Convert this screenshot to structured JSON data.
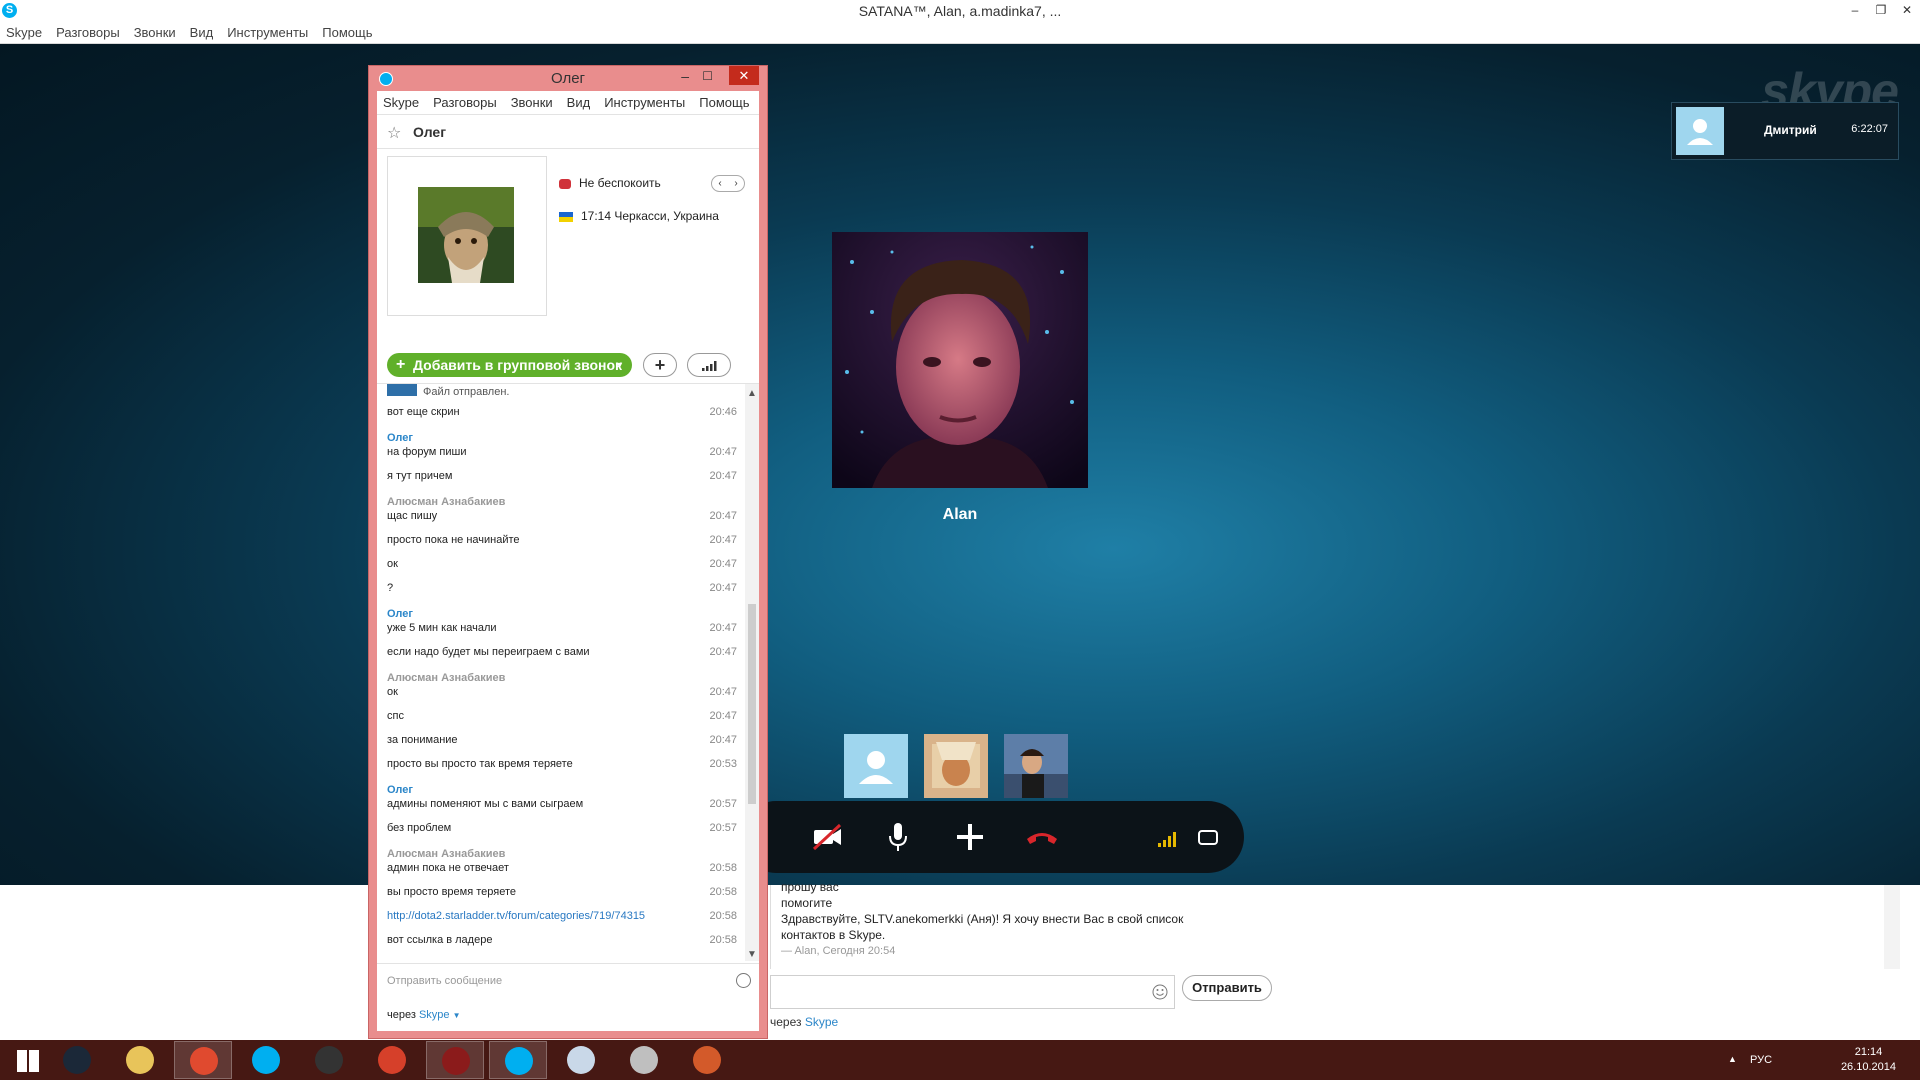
{
  "main_window": {
    "title": "SATANA™, Alan, a.madinka7, ...",
    "menu": [
      "Skype",
      "Разговоры",
      "Звонки",
      "Вид",
      "Инструменты",
      "Помощь"
    ],
    "window_controls": [
      "–",
      "❐",
      "✕"
    ]
  },
  "call": {
    "watermark": "skype",
    "notification": {
      "name": "Дмитрий",
      "time": "6:22:07"
    },
    "remote_participant": "Alan",
    "participants_thumbnails": [
      "default-avatar",
      "photo",
      "photo"
    ],
    "controls": [
      "video-off-icon",
      "microphone-icon",
      "plus-icon",
      "hang-up-icon",
      "signal-icon",
      "fullscreen-icon"
    ]
  },
  "main_chat": {
    "lines": [
      "прошу вас",
      "помогите",
      "Здравствуйте, SLTV.anekomerkki (Аня)! Я хочу внести Вас в свой список",
      "контактов в Skype."
    ],
    "meta": "— Alan, Сегодня 20:54",
    "send_label": "Отправить",
    "via_prefix": "через",
    "via_service": "Skype"
  },
  "chat_window": {
    "title": "Олег",
    "menu": [
      "Skype",
      "Разговоры",
      "Звонки",
      "Вид",
      "Инструменты",
      "Помощь"
    ],
    "contact_name": "Олег",
    "status": "Не беспокоить",
    "local_time": "17:14",
    "location": "Черкасси, Украина",
    "add_group_call_label": "Добавить в групповой звонок",
    "file_sent": "Файл отправлен.",
    "messages": [
      {
        "text": "вот еще скрин",
        "time": "20:46"
      },
      {
        "sender": "Олег"
      },
      {
        "text": "на форум пиши",
        "time": "20:47"
      },
      {
        "text": "я тут причем",
        "time": "20:47"
      },
      {
        "sender": "Алюсман Азнабакиев"
      },
      {
        "text": "щас пишу",
        "time": "20:47"
      },
      {
        "text": "просто пока не начинайте",
        "time": "20:47"
      },
      {
        "text": "ок",
        "time": "20:47"
      },
      {
        "text": "?",
        "time": "20:47"
      },
      {
        "sender": "Олег"
      },
      {
        "text": "уже 5 мин как начали",
        "time": "20:47"
      },
      {
        "text": "если надо будет мы переиграем с вами",
        "time": "20:47"
      },
      {
        "sender": "Алюсман Азнабакиев"
      },
      {
        "text": "ок",
        "time": "20:47"
      },
      {
        "text": "спс",
        "time": "20:47"
      },
      {
        "text": "за понимание",
        "time": "20:47"
      },
      {
        "text": "просто вы просто так время теряете",
        "time": "20:53"
      },
      {
        "sender": "Олег"
      },
      {
        "text": "админы поменяют мы с вами сыграем",
        "time": "20:57"
      },
      {
        "text": "без проблем",
        "time": "20:57"
      },
      {
        "sender": "Алюсман Азнабакиев"
      },
      {
        "text": "админ пока не отвечает",
        "time": "20:58"
      },
      {
        "text": "вы просто время теряете",
        "time": "20:58"
      },
      {
        "text": "http://dota2.starladder.tv/forum/categories/719/74315",
        "time": "20:58"
      },
      {
        "text": "вот ссылка в ладере",
        "time": "20:58"
      }
    ],
    "compose_placeholder": "Отправить сообщение",
    "via_prefix": "через",
    "via_service": "Skype"
  },
  "taskbar": {
    "apps": [
      "windows-start",
      "steam",
      "file-explorer",
      "chrome",
      "skype",
      "obs",
      "jar-tool",
      "dota-2",
      "skype-active",
      "image-viewer",
      "media-player",
      "office-doc"
    ],
    "tray": {
      "language": "РУС",
      "time": "21:14",
      "date": "26.10.2014"
    }
  },
  "colors": {
    "chat_window_frame": "#e98d8d",
    "oleg_name": "#2b86c9",
    "self_name": "#999999",
    "add_call_green": "#60b02a",
    "hangup_red": "#d8262b",
    "taskbar": "#461813"
  }
}
